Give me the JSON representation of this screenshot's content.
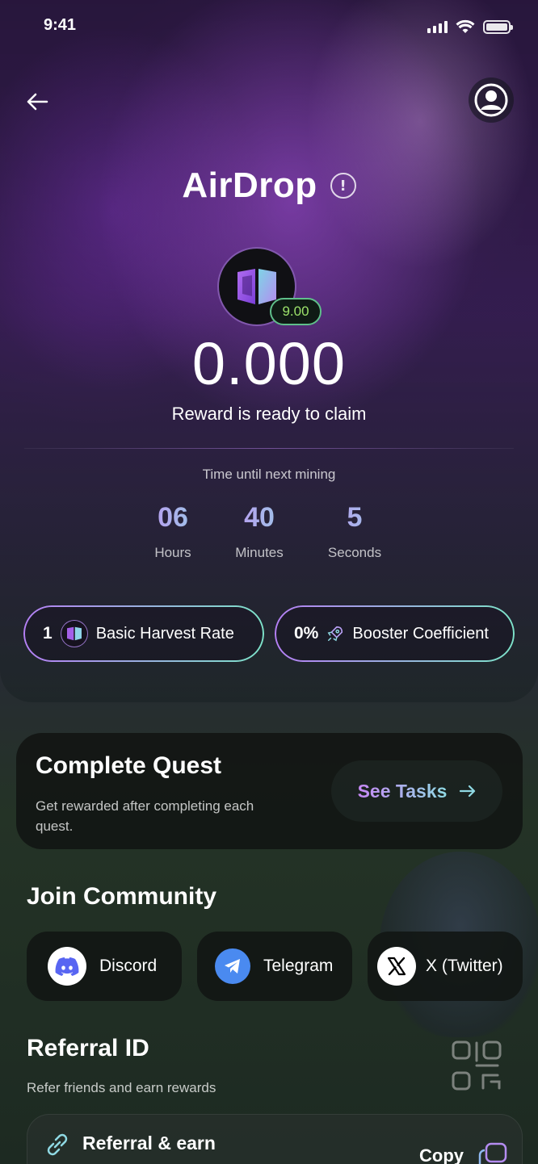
{
  "status_bar": {
    "time": "9:41"
  },
  "header": {
    "title": "AirDrop"
  },
  "token": {
    "badge_value": "9.00"
  },
  "reward": {
    "amount": "0.000",
    "status_text": "Reward is ready to claim"
  },
  "mining": {
    "label": "Time until next mining",
    "hours": "06",
    "hours_label": "Hours",
    "minutes": "40",
    "minutes_label": "Minutes",
    "seconds": "5",
    "seconds_label": "Seconds"
  },
  "stats": {
    "harvest_value": "1",
    "harvest_label": "Basic Harvest Rate",
    "booster_value": "0%",
    "booster_label": "Booster Coefficient"
  },
  "quest": {
    "title": "Complete Quest",
    "subtitle": "Get rewarded after completing each quest.",
    "button_label": "See Tasks"
  },
  "community": {
    "title": "Join Community",
    "items": [
      {
        "label": "Discord",
        "icon": "discord-icon",
        "color": "#5865F2"
      },
      {
        "label": "Telegram",
        "icon": "telegram-icon",
        "color": "#3b82f6"
      },
      {
        "label": "X (Twitter)",
        "icon": "x-icon",
        "color": "#ffffff"
      }
    ]
  },
  "referral": {
    "title": "Referral ID",
    "subtitle": "Refer friends and earn rewards",
    "card_label": "Referral & earn",
    "copy_label": "Copy"
  },
  "colors": {
    "accent_gradient_start": "#c788f5",
    "accent_gradient_end": "#8fd9e3",
    "badge_green": "#9de36b"
  }
}
